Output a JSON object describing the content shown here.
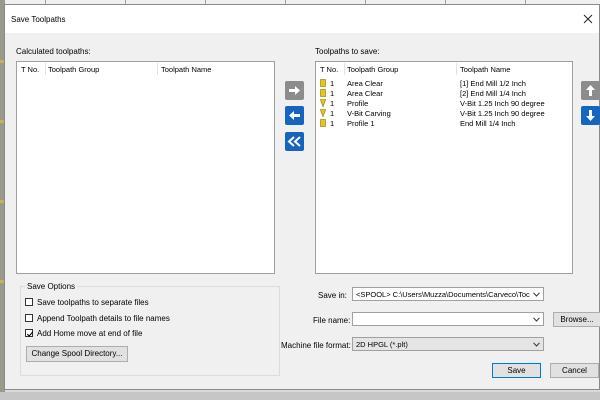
{
  "dialog": {
    "title": "Save Toolpaths"
  },
  "calculated": {
    "label": "Calculated toolpaths:",
    "columns": [
      "T No.",
      "Toolpath Group",
      "Toolpath Name"
    ]
  },
  "to_save": {
    "label": "Toolpaths to save:",
    "columns": [
      "T No.",
      "Toolpath Group",
      "Toolpath Name"
    ],
    "rows": [
      {
        "tno": "1",
        "group": "Area Clear",
        "name": "[1] End Mill 1/2 Inch",
        "icon": "end-mill-icon"
      },
      {
        "tno": "1",
        "group": "Area Clear",
        "name": "[2] End Mill 1/4 Inch",
        "icon": "end-mill-icon"
      },
      {
        "tno": "1",
        "group": "Profile",
        "name": "V-Bit 1.25 Inch 90 degree",
        "icon": "v-bit-icon"
      },
      {
        "tno": "1",
        "group": "V-Bit Carving",
        "name": "V-Bit 1.25 Inch 90 degree",
        "icon": "v-bit-icon"
      },
      {
        "tno": "1",
        "group": "Profile 1",
        "name": "End Mill 1/4 Inch",
        "icon": "end-mill-icon"
      }
    ]
  },
  "save_options": {
    "title": "Save Options",
    "separate": {
      "label": "Save toolpaths to separate files",
      "checked": false
    },
    "append": {
      "label": "Append Toolpath details to file names",
      "checked": false
    },
    "home": {
      "label": "Add Home move at end of file",
      "checked": true
    },
    "spool_button": "Change Spool Directory..."
  },
  "save_in": {
    "label": "Save in:",
    "value": "<SPOOL> C:\\Users\\Muzza\\Documents\\Carveco\\Toc"
  },
  "file_name": {
    "label": "File name:",
    "value": "",
    "browse": "Browse..."
  },
  "machine_format": {
    "label": "Machine file format:",
    "value": "2D HPGL (*.plt)"
  },
  "buttons": {
    "save": "Save",
    "cancel": "Cancel"
  },
  "colors": {
    "accent": "#0078d7",
    "arrow_blue": "#1565c0",
    "arrow_grey": "#8c8c8c",
    "tool_yellow": "#e6c619"
  }
}
